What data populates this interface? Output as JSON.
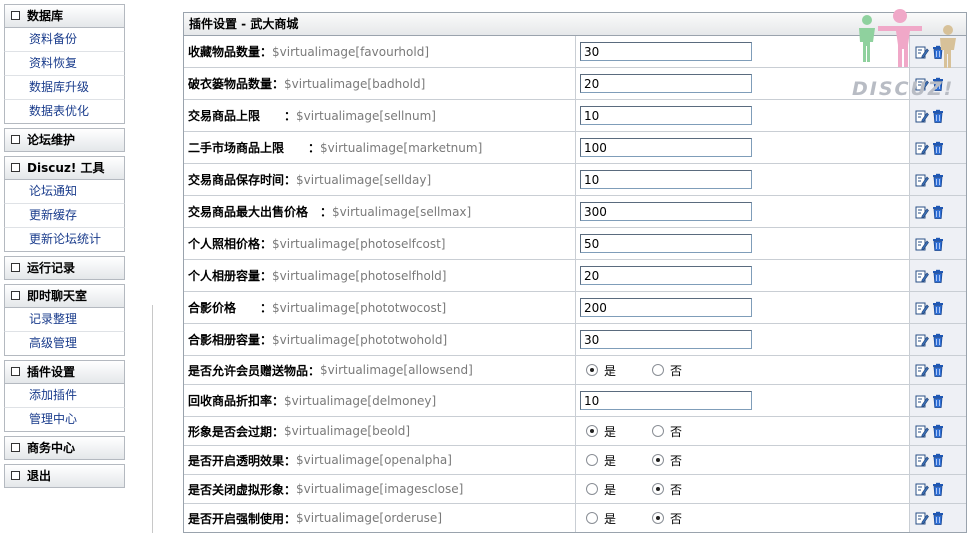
{
  "sidebar": {
    "groups": [
      {
        "title": "数据库",
        "items": [
          "资料备份",
          "资料恢复",
          "数据库升级",
          "数据表优化"
        ]
      },
      {
        "title": "论坛维护",
        "items": []
      },
      {
        "title": "Discuz! 工具",
        "items": [
          "论坛通知",
          "更新缓存",
          "更新论坛统计"
        ]
      },
      {
        "title": "运行记录",
        "items": []
      },
      {
        "title": "即时聊天室",
        "items": [
          "记录整理",
          "高级管理"
        ]
      },
      {
        "title": "插件设置",
        "items": [
          "添加插件",
          "管理中心"
        ]
      },
      {
        "title": "商务中心",
        "items": []
      },
      {
        "title": "退出",
        "items": []
      }
    ]
  },
  "panel": {
    "title": "插件设置 - 武大商城",
    "logo_text": "DISCUZ!",
    "radio_yes": "是",
    "radio_no": "否",
    "rows": [
      {
        "label": "收藏物品数量：",
        "var": "$virtualimage[favourhold]",
        "type": "text",
        "value": "30"
      },
      {
        "label": "破衣篓物品数量：",
        "var": "$virtualimage[badhold]",
        "type": "text",
        "value": "20"
      },
      {
        "label": "交易商品上限　　：",
        "var": "$virtualimage[sellnum]",
        "type": "text",
        "value": "10"
      },
      {
        "label": "二手市场商品上限　　：",
        "var": "$virtualimage[marketnum]",
        "type": "text",
        "value": "100"
      },
      {
        "label": "交易商品保存时间：",
        "var": "$virtualimage[sellday]",
        "type": "text",
        "value": "10"
      },
      {
        "label": "交易商品最大出售价格　：",
        "var": "$virtualimage[sellmax]",
        "type": "text",
        "value": "300"
      },
      {
        "label": "个人照相价格：",
        "var": "$virtualimage[photoselfcost]",
        "type": "text",
        "value": "50"
      },
      {
        "label": "个人相册容量：",
        "var": "$virtualimage[photoselfhold]",
        "type": "text",
        "value": "20"
      },
      {
        "label": "合影价格　　：",
        "var": "$virtualimage[phototwocost]",
        "type": "text",
        "value": "200"
      },
      {
        "label": "合影相册容量：",
        "var": "$virtualimage[phototwohold]",
        "type": "text",
        "value": "30"
      },
      {
        "label": "是否允许会员赠送物品：",
        "var": "$virtualimage[allowsend]",
        "type": "radio",
        "value": "是"
      },
      {
        "label": "回收商品折扣率：",
        "var": "$virtualimage[delmoney]",
        "type": "text",
        "value": "10"
      },
      {
        "label": "形象是否会过期：",
        "var": "$virtualimage[beold]",
        "type": "radio",
        "value": "是"
      },
      {
        "label": "是否开启透明效果：",
        "var": "$virtualimage[openalpha]",
        "type": "radio",
        "value": "否"
      },
      {
        "label": "是否关闭虚拟形象：",
        "var": "$virtualimage[imagesclose]",
        "type": "radio",
        "value": "否"
      },
      {
        "label": "是否开启强制使用：",
        "var": "$virtualimage[orderuse]",
        "type": "radio",
        "value": "否"
      }
    ]
  },
  "icons": {
    "edit": "edit-icon",
    "delete": "trash-icon"
  },
  "colors": {
    "link": "#1a3c8c",
    "var_text": "#7a7a7a",
    "action_cell_bg": "#eef0f5"
  }
}
